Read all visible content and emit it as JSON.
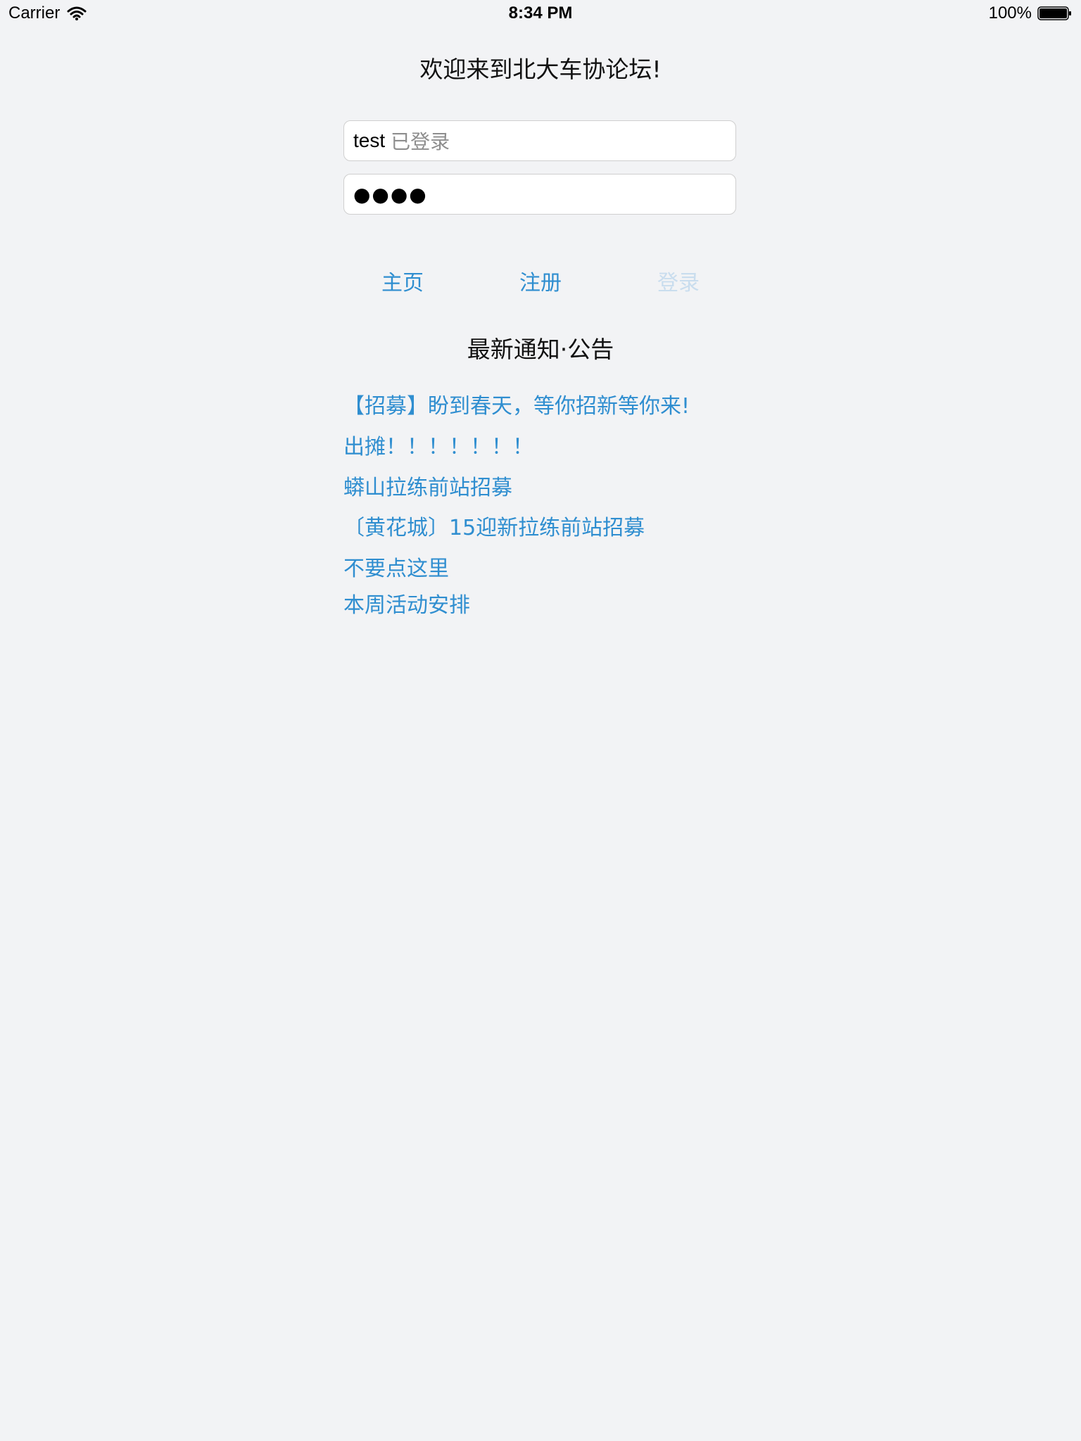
{
  "status_bar": {
    "carrier": "Carrier",
    "time": "8:34 PM",
    "battery": "100%"
  },
  "title": "欢迎来到北大车协论坛!",
  "login_form": {
    "username_value": "test",
    "username_status": "已登录",
    "password_masked": "●●●●"
  },
  "nav": {
    "home": "主页",
    "register": "注册",
    "login": "登录"
  },
  "notices": {
    "heading": "最新通知·公告",
    "items": [
      "【招募】盼到春天，等你招新等你来!",
      "出摊！！！！！！！",
      "蟒山拉练前站招募",
      "〔黄花城〕15迎新拉练前站招募",
      "不要点这里",
      "本周活动安排"
    ]
  },
  "colors": {
    "background": "#f2f3f5",
    "link": "#2f8ed0",
    "disabled_link": "#c9ddee"
  }
}
